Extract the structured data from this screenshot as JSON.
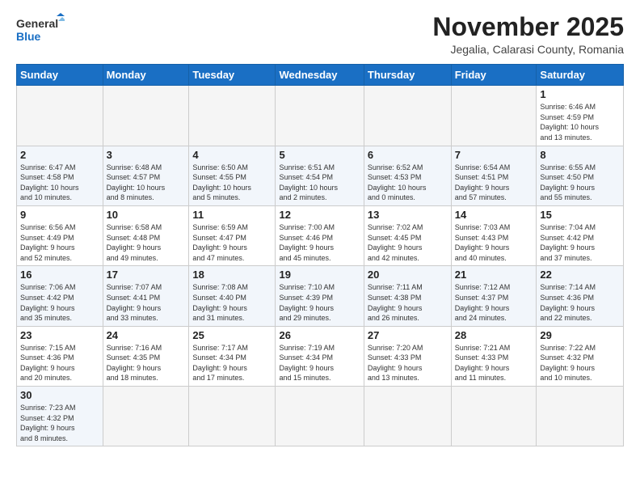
{
  "header": {
    "logo_general": "General",
    "logo_blue": "Blue",
    "month_title": "November 2025",
    "subtitle": "Jegalia, Calarasi County, Romania"
  },
  "weekdays": [
    "Sunday",
    "Monday",
    "Tuesday",
    "Wednesday",
    "Thursday",
    "Friday",
    "Saturday"
  ],
  "weeks": [
    [
      {
        "day": "",
        "info": ""
      },
      {
        "day": "",
        "info": ""
      },
      {
        "day": "",
        "info": ""
      },
      {
        "day": "",
        "info": ""
      },
      {
        "day": "",
        "info": ""
      },
      {
        "day": "",
        "info": ""
      },
      {
        "day": "1",
        "info": "Sunrise: 6:46 AM\nSunset: 4:59 PM\nDaylight: 10 hours\nand 13 minutes."
      }
    ],
    [
      {
        "day": "2",
        "info": "Sunrise: 6:47 AM\nSunset: 4:58 PM\nDaylight: 10 hours\nand 10 minutes."
      },
      {
        "day": "3",
        "info": "Sunrise: 6:48 AM\nSunset: 4:57 PM\nDaylight: 10 hours\nand 8 minutes."
      },
      {
        "day": "4",
        "info": "Sunrise: 6:50 AM\nSunset: 4:55 PM\nDaylight: 10 hours\nand 5 minutes."
      },
      {
        "day": "5",
        "info": "Sunrise: 6:51 AM\nSunset: 4:54 PM\nDaylight: 10 hours\nand 2 minutes."
      },
      {
        "day": "6",
        "info": "Sunrise: 6:52 AM\nSunset: 4:53 PM\nDaylight: 10 hours\nand 0 minutes."
      },
      {
        "day": "7",
        "info": "Sunrise: 6:54 AM\nSunset: 4:51 PM\nDaylight: 9 hours\nand 57 minutes."
      },
      {
        "day": "8",
        "info": "Sunrise: 6:55 AM\nSunset: 4:50 PM\nDaylight: 9 hours\nand 55 minutes."
      }
    ],
    [
      {
        "day": "9",
        "info": "Sunrise: 6:56 AM\nSunset: 4:49 PM\nDaylight: 9 hours\nand 52 minutes."
      },
      {
        "day": "10",
        "info": "Sunrise: 6:58 AM\nSunset: 4:48 PM\nDaylight: 9 hours\nand 49 minutes."
      },
      {
        "day": "11",
        "info": "Sunrise: 6:59 AM\nSunset: 4:47 PM\nDaylight: 9 hours\nand 47 minutes."
      },
      {
        "day": "12",
        "info": "Sunrise: 7:00 AM\nSunset: 4:46 PM\nDaylight: 9 hours\nand 45 minutes."
      },
      {
        "day": "13",
        "info": "Sunrise: 7:02 AM\nSunset: 4:45 PM\nDaylight: 9 hours\nand 42 minutes."
      },
      {
        "day": "14",
        "info": "Sunrise: 7:03 AM\nSunset: 4:43 PM\nDaylight: 9 hours\nand 40 minutes."
      },
      {
        "day": "15",
        "info": "Sunrise: 7:04 AM\nSunset: 4:42 PM\nDaylight: 9 hours\nand 37 minutes."
      }
    ],
    [
      {
        "day": "16",
        "info": "Sunrise: 7:06 AM\nSunset: 4:42 PM\nDaylight: 9 hours\nand 35 minutes."
      },
      {
        "day": "17",
        "info": "Sunrise: 7:07 AM\nSunset: 4:41 PM\nDaylight: 9 hours\nand 33 minutes."
      },
      {
        "day": "18",
        "info": "Sunrise: 7:08 AM\nSunset: 4:40 PM\nDaylight: 9 hours\nand 31 minutes."
      },
      {
        "day": "19",
        "info": "Sunrise: 7:10 AM\nSunset: 4:39 PM\nDaylight: 9 hours\nand 29 minutes."
      },
      {
        "day": "20",
        "info": "Sunrise: 7:11 AM\nSunset: 4:38 PM\nDaylight: 9 hours\nand 26 minutes."
      },
      {
        "day": "21",
        "info": "Sunrise: 7:12 AM\nSunset: 4:37 PM\nDaylight: 9 hours\nand 24 minutes."
      },
      {
        "day": "22",
        "info": "Sunrise: 7:14 AM\nSunset: 4:36 PM\nDaylight: 9 hours\nand 22 minutes."
      }
    ],
    [
      {
        "day": "23",
        "info": "Sunrise: 7:15 AM\nSunset: 4:36 PM\nDaylight: 9 hours\nand 20 minutes."
      },
      {
        "day": "24",
        "info": "Sunrise: 7:16 AM\nSunset: 4:35 PM\nDaylight: 9 hours\nand 18 minutes."
      },
      {
        "day": "25",
        "info": "Sunrise: 7:17 AM\nSunset: 4:34 PM\nDaylight: 9 hours\nand 17 minutes."
      },
      {
        "day": "26",
        "info": "Sunrise: 7:19 AM\nSunset: 4:34 PM\nDaylight: 9 hours\nand 15 minutes."
      },
      {
        "day": "27",
        "info": "Sunrise: 7:20 AM\nSunset: 4:33 PM\nDaylight: 9 hours\nand 13 minutes."
      },
      {
        "day": "28",
        "info": "Sunrise: 7:21 AM\nSunset: 4:33 PM\nDaylight: 9 hours\nand 11 minutes."
      },
      {
        "day": "29",
        "info": "Sunrise: 7:22 AM\nSunset: 4:32 PM\nDaylight: 9 hours\nand 10 minutes."
      }
    ],
    [
      {
        "day": "30",
        "info": "Sunrise: 7:23 AM\nSunset: 4:32 PM\nDaylight: 9 hours\nand 8 minutes."
      },
      {
        "day": "",
        "info": ""
      },
      {
        "day": "",
        "info": ""
      },
      {
        "day": "",
        "info": ""
      },
      {
        "day": "",
        "info": ""
      },
      {
        "day": "",
        "info": ""
      },
      {
        "day": "",
        "info": ""
      }
    ]
  ]
}
